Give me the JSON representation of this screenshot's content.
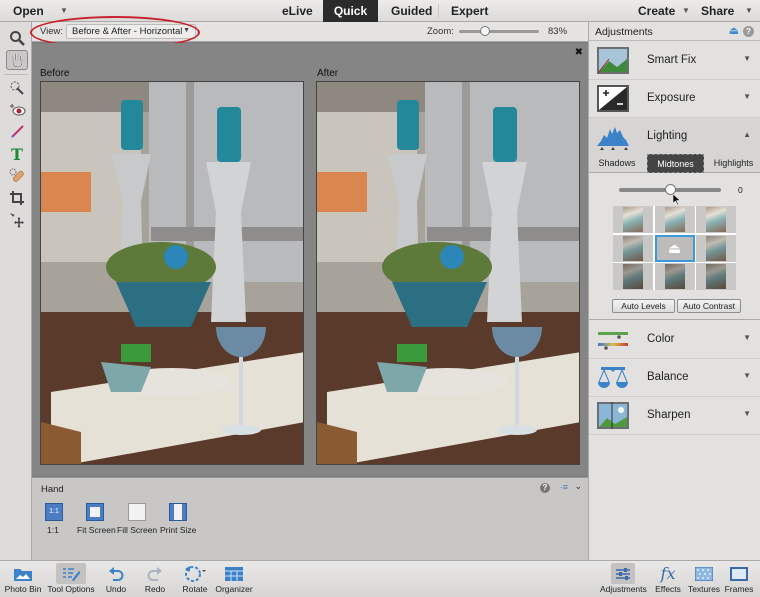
{
  "topbar": {
    "open_label": "Open",
    "modes": [
      "eLive",
      "Quick",
      "Guided",
      "Expert"
    ],
    "active_mode": "Quick",
    "create_label": "Create",
    "share_label": "Share"
  },
  "options_bar": {
    "view_label": "View:",
    "view_value": "Before & After - Horizontal",
    "zoom_label": "Zoom:",
    "zoom_value": "83%",
    "zoom_fraction": 0.33,
    "annotation_color": "#c8202a"
  },
  "canvas": {
    "before_label": "Before",
    "after_label": "After",
    "close_glyph": "✖"
  },
  "toolbox": {
    "tools": [
      "zoom-tool",
      "hand-tool",
      "quick-selection-tool",
      "red-eye-tool",
      "whiten-teeth-tool",
      "type-tool",
      "spot-healing-tool",
      "crop-tool",
      "move-tool"
    ],
    "active_tool": "hand-tool"
  },
  "tool_options": {
    "title": "Hand",
    "buttons": [
      {
        "label": "1:1",
        "icon_text": "1:1"
      },
      {
        "label": "Fit Screen"
      },
      {
        "label": "Fill Screen"
      },
      {
        "label": "Print Size"
      }
    ]
  },
  "adjustments": {
    "title": "Adjustments",
    "items": [
      {
        "label": "Smart Fix",
        "expanded": false
      },
      {
        "label": "Exposure",
        "expanded": false
      },
      {
        "label": "Lighting",
        "expanded": true
      },
      {
        "label": "Color",
        "expanded": false
      },
      {
        "label": "Balance",
        "expanded": false
      },
      {
        "label": "Sharpen",
        "expanded": false
      }
    ],
    "lighting": {
      "tabs": [
        "Shadows",
        "Midtones",
        "Highlights"
      ],
      "active_tab": "Midtones",
      "slider_value": "0",
      "slider_fraction": 0.5,
      "selected_cell": 4,
      "auto_levels_label": "Auto Levels",
      "auto_contrast_label": "Auto Contrast"
    },
    "accent_color": "#3a9ad9"
  },
  "bottombar": {
    "left": [
      {
        "label": "Photo Bin"
      },
      {
        "label": "Tool Options",
        "active": true
      },
      {
        "label": "Undo"
      },
      {
        "label": "Redo"
      },
      {
        "label": "Rotate"
      },
      {
        "label": "Organizer"
      }
    ],
    "right": [
      {
        "label": "Adjustments",
        "active": true
      },
      {
        "label": "Effects"
      },
      {
        "label": "Textures"
      },
      {
        "label": "Frames"
      }
    ]
  }
}
